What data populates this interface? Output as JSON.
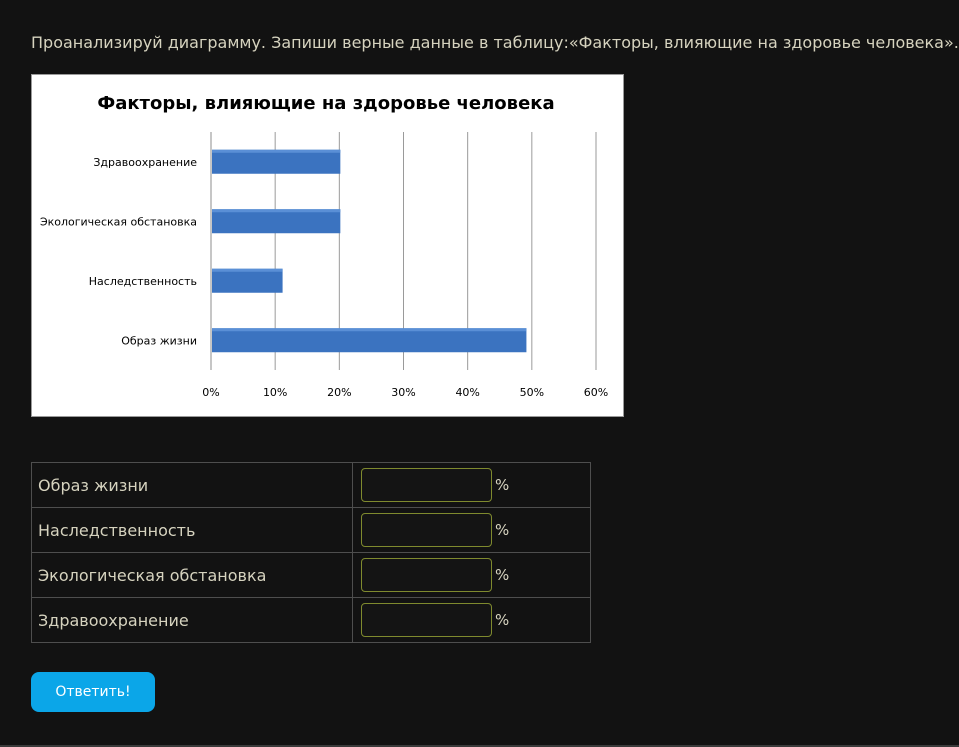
{
  "task": {
    "text": "Проанализируй диаграмму. Запиши верные данные в таблицу:«Факторы, влияющие на здоровье человека»."
  },
  "chart_data": {
    "type": "bar",
    "orientation": "horizontal",
    "title": "Факторы, влияющие на здоровье человека",
    "categories": [
      "Здравоохранение",
      "Экологическая обстановка",
      "Наследственность",
      "Образ жизни"
    ],
    "values": [
      20,
      20,
      11,
      49
    ],
    "x_tick_labels": [
      "0%",
      "10%",
      "20%",
      "30%",
      "40%",
      "50%",
      "60%"
    ],
    "xlim": [
      0,
      60
    ],
    "grid": "vertical",
    "bar_color": "#3b73c0"
  },
  "answer_table": {
    "rows": [
      {
        "label": "Образ жизни",
        "value": "",
        "unit": "%"
      },
      {
        "label": "Наследственность",
        "value": "",
        "unit": "%"
      },
      {
        "label": "Экологическая обстановка",
        "value": "",
        "unit": "%"
      },
      {
        "label": "Здравоохранение",
        "value": "",
        "unit": "%"
      }
    ]
  },
  "submit": {
    "label": "Ответить!"
  }
}
